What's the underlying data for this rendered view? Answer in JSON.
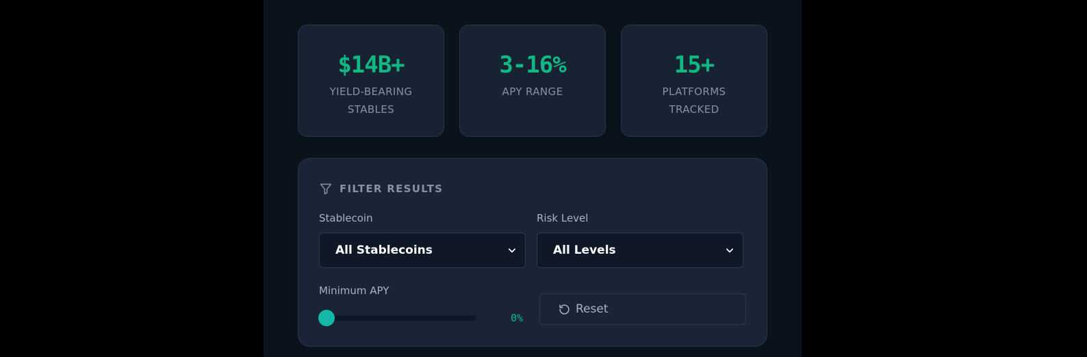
{
  "stats": [
    {
      "value": "$14B+",
      "label": "YIELD-BEARING STABLES"
    },
    {
      "value": "3-16%",
      "label": "APY RANGE"
    },
    {
      "value": "15+",
      "label": "PLATFORMS TRACKED"
    }
  ],
  "filter": {
    "icon": "filter-icon",
    "title": "FILTER RESULTS",
    "stablecoin": {
      "label": "Stablecoin",
      "selected": "All Stablecoins"
    },
    "risk": {
      "label": "Risk Level",
      "selected": "All Levels"
    },
    "min_apy": {
      "label": "Minimum APY",
      "value": 0,
      "display": "0%"
    },
    "reset": {
      "icon": "reset-icon",
      "label": "Reset"
    }
  },
  "colors": {
    "accent": "#10b981",
    "slider_thumb": "#14b8a6",
    "panel_background": "#1a2436",
    "page_background": "#0a131b"
  }
}
